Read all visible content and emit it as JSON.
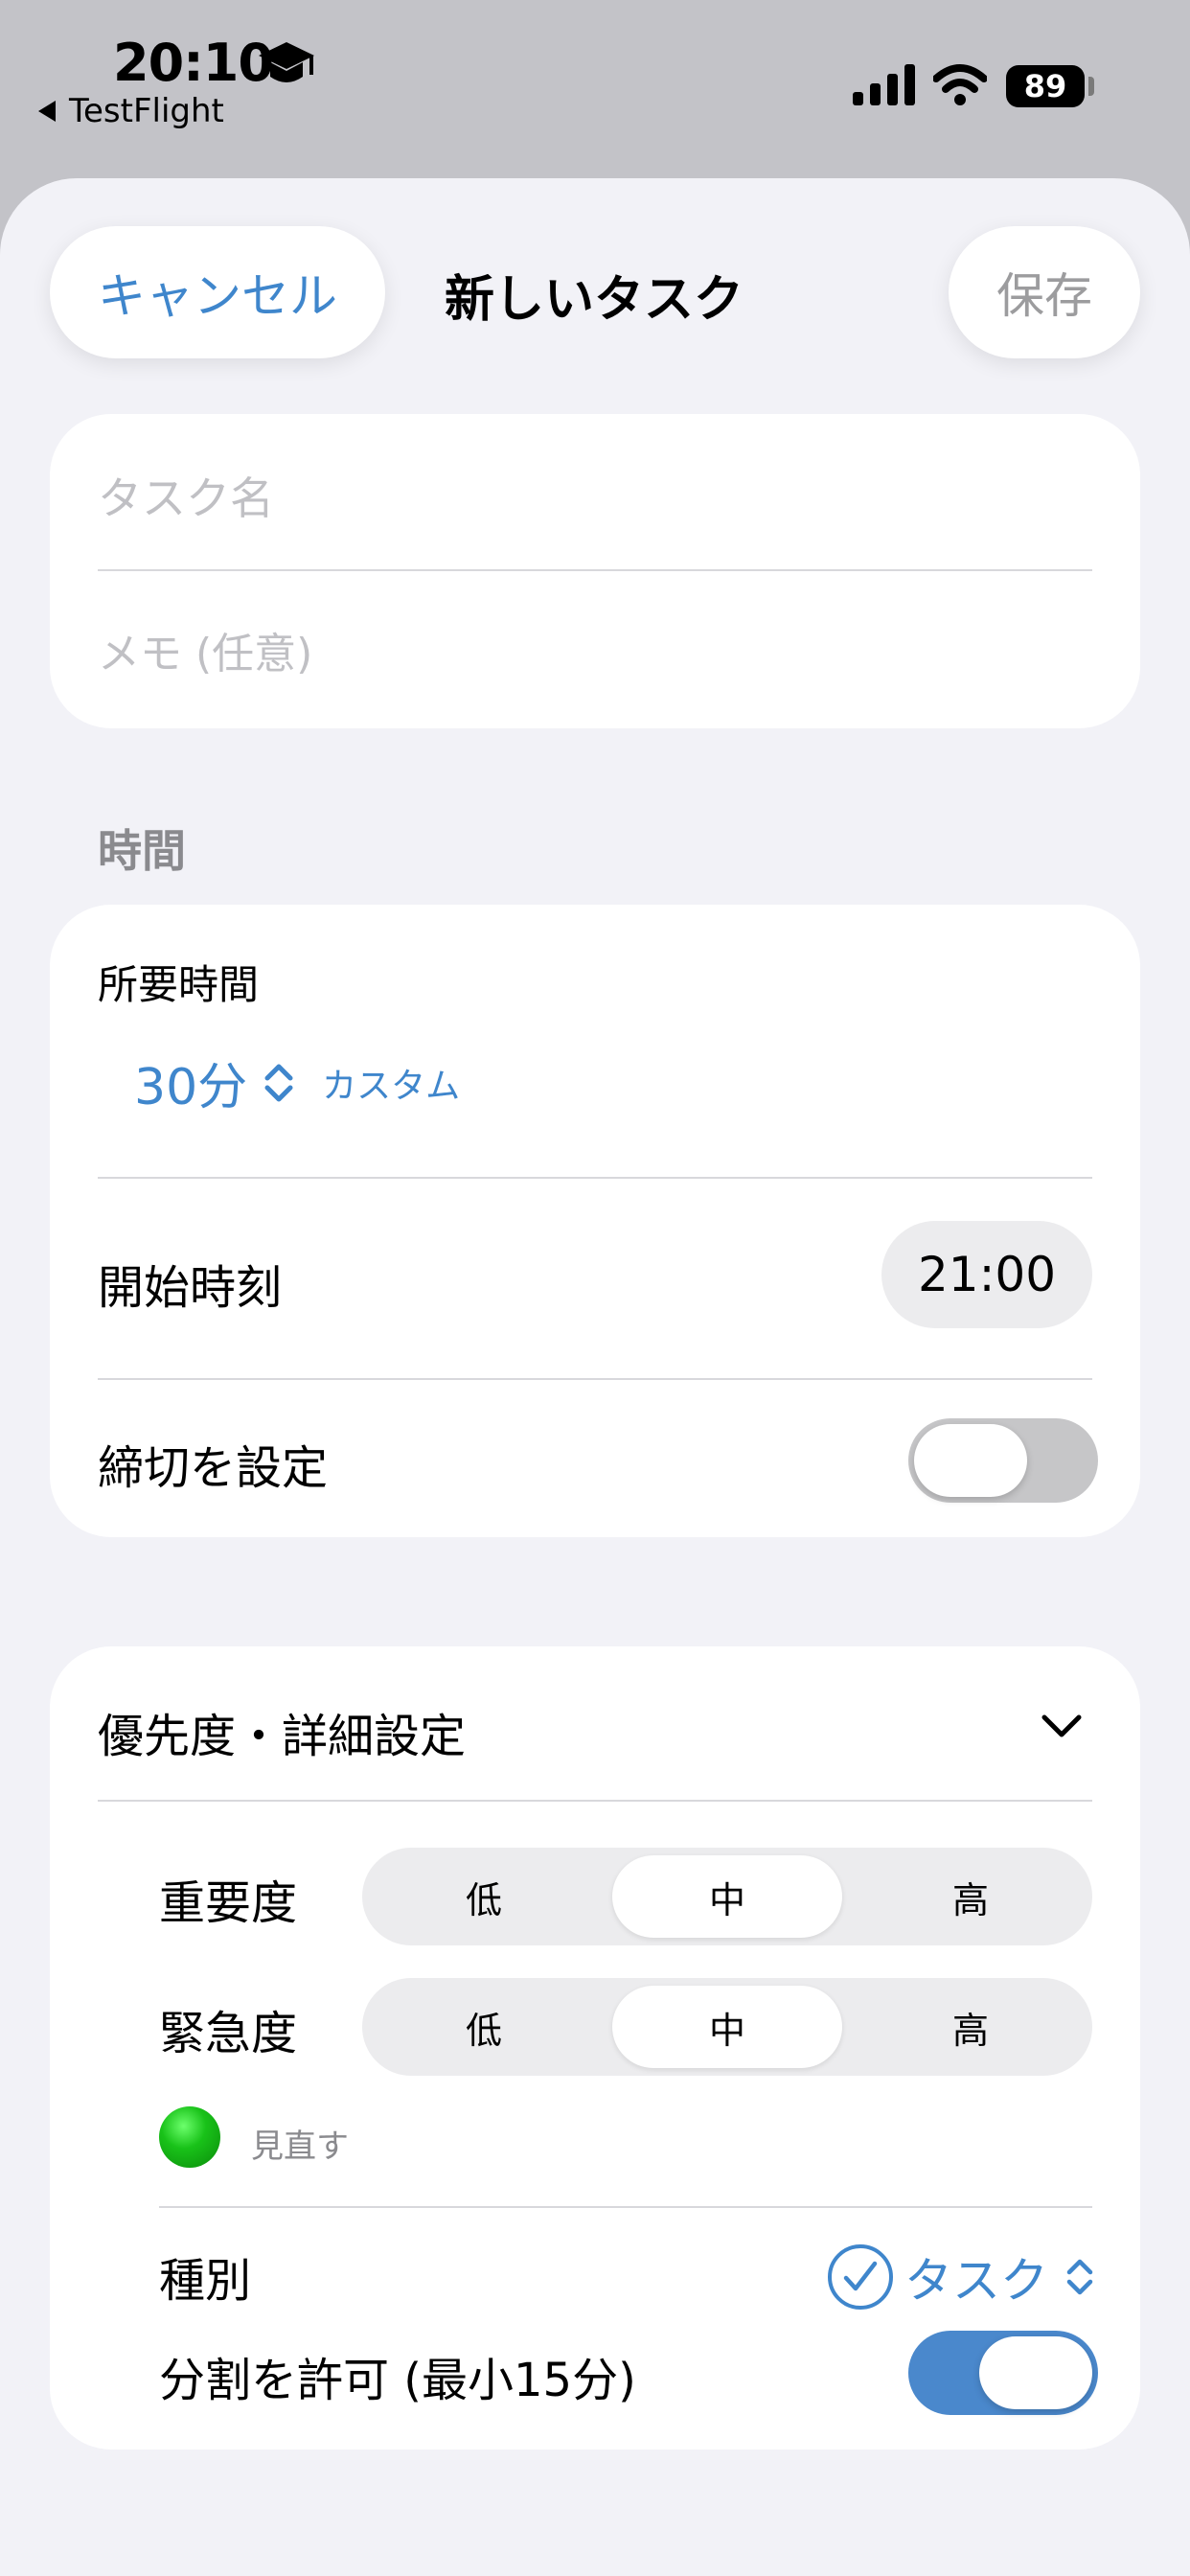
{
  "status_bar": {
    "time": "20:10",
    "back_app": "TestFlight",
    "battery": "89"
  },
  "nav": {
    "cancel_label": "キャンセル",
    "title": "新しいタスク",
    "save_label": "保存"
  },
  "task_form": {
    "name_placeholder": "タスク名",
    "memo_placeholder": "メモ (任意)"
  },
  "time_section": {
    "header": "時間",
    "duration_label": "所要時間",
    "duration_value": "30分",
    "custom_label": "カスタム",
    "start_label": "開始時刻",
    "start_value": "21:00",
    "deadline_label": "締切を設定",
    "deadline_enabled": false
  },
  "priority_section": {
    "header": "優先度・詳細設定",
    "importance_label": "重要度",
    "urgency_label": "緊急度",
    "options": [
      "低",
      "中",
      "高"
    ],
    "importance_selected": "中",
    "urgency_selected": "中",
    "status_text": "見直す",
    "type_label": "種別",
    "type_value": "タスク",
    "split_label": "分割を許可 (最小15分)",
    "split_enabled": true
  },
  "colors": {
    "accent": "#3f86cc",
    "toggle_on": "#4a88cc",
    "status_dot": "#19c219"
  }
}
